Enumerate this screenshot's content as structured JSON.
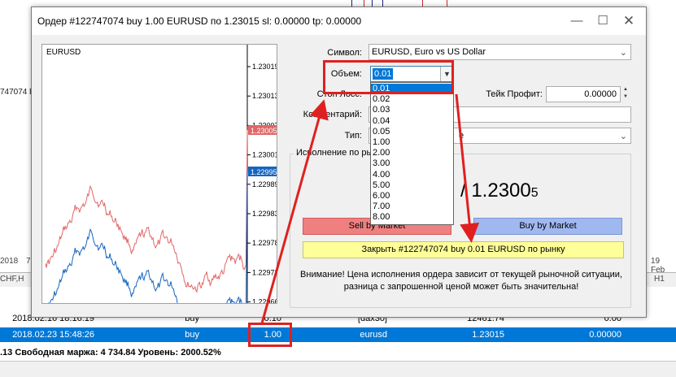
{
  "background": {
    "left_fragment": "747074 bu",
    "tab_left": "2018",
    "tab_left2": "7",
    "pair_left": "CHF,H",
    "date_right": "19 Feb",
    "tab_right": "H1",
    "rows": [
      {
        "date": "2018.02.16 18:16:19",
        "type": "buy",
        "volume": "0.10",
        "symbol": "[dax30]",
        "price": "12461.74",
        "profit": "0.00"
      },
      {
        "date": "2018.02.23 15:48:26",
        "type": "buy",
        "volume": "1.00",
        "symbol": "eurusd",
        "price": "1.23015",
        "profit": "0.00000"
      }
    ],
    "status": ".13  Свободная маржа: 4 734.84  Уровень: 2000.52%"
  },
  "dialog": {
    "title": "Ордер #122747074 buy 1.00 EURUSD по 1.23015 sl: 0.00000 tp: 0.00000",
    "minimize_icon": "minimize-icon",
    "maximize_icon": "maximize-icon",
    "close_icon": "close-icon"
  },
  "chart": {
    "symbol": "EURUSD",
    "ask_label": "1.23005",
    "bid_label": "1.22995",
    "ask_color": "#e06666",
    "bid_color": "#1565c0",
    "tick_labels": [
      "1.23019",
      "1.23013",
      "1.23007",
      "1.23001",
      "1.22989",
      "1.22983",
      "1.22978",
      "1.22972",
      "1.22966"
    ]
  },
  "form": {
    "symbol_label": "Символ:",
    "symbol_value": "EURUSD, Euro vs US Dollar",
    "volume_label": "Объем:",
    "volume_value": "0.01",
    "stoploss_label": "Стоп Лосс:",
    "takeprofit_label": "Тейк Профит:",
    "takeprofit_value": "0.00000",
    "comment_label": "Комментарий:",
    "type_label": "Тип:",
    "type_value": "е",
    "exec_group_label": "Исполнение по ры",
    "price_main": "/ 1.2300",
    "price_small": "5",
    "sell_button": "Sell by Market",
    "buy_button": "Buy by Market",
    "close_button": "Закрыть #122747074 buy 0.01 EURUSD по рынку",
    "warning_line1": "Внимание! Цена исполнения ордера зависит от текущей рыночной ситуации,",
    "warning_line2": "разница с запрошенной ценой может быть значительна!"
  },
  "volume_options": [
    "0.01",
    "0.02",
    "0.03",
    "0.04",
    "0.05",
    "1.00",
    "2.00",
    "3.00",
    "4.00",
    "5.00",
    "6.00",
    "7.00",
    "8.00"
  ],
  "annotation_color": "#e02020"
}
